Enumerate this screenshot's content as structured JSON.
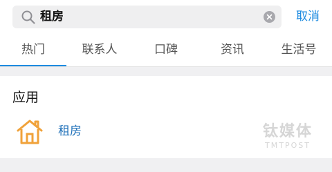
{
  "search": {
    "query": "租房",
    "cancel_label": "取消"
  },
  "tabs": [
    {
      "label": "热门",
      "active": true
    },
    {
      "label": "联系人",
      "active": false
    },
    {
      "label": "口碑",
      "active": false
    },
    {
      "label": "资讯",
      "active": false
    },
    {
      "label": "生活号",
      "active": false
    }
  ],
  "section": {
    "title": "应用",
    "items": [
      {
        "label": "租房",
        "icon": "house-icon"
      }
    ]
  },
  "watermark": {
    "cn": "钛媒体",
    "en": "TMTPOST"
  },
  "colors": {
    "accent": "#1d8be0",
    "icon_orange": "#f0a23a",
    "background_gray": "#f0f0f2"
  }
}
